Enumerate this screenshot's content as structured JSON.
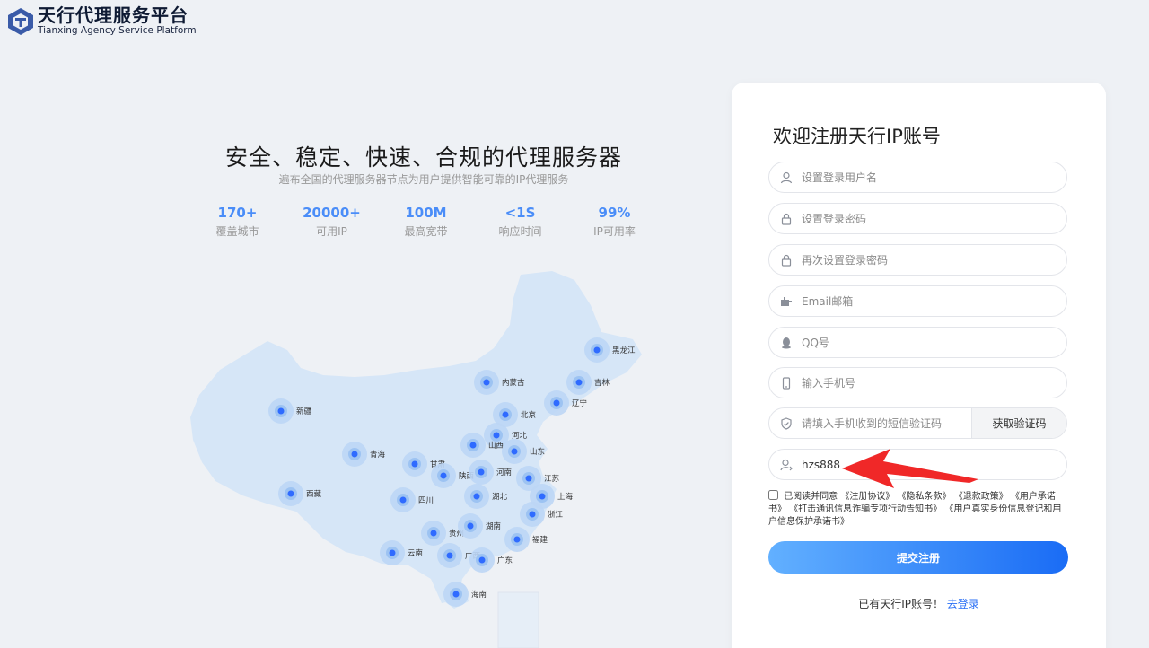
{
  "brand": {
    "name_cn": "天行代理服务平台",
    "name_en": "Tianxing Agency Service Platform",
    "logo_icon": "tx-hex-logo-icon"
  },
  "hero": {
    "title": "安全、稳定、快速、合规的代理服务器",
    "subtitle": "遍布全国的代理服务器节点为用户提供智能可靠的IP代理服务",
    "stats": [
      {
        "value": "170+",
        "label": "覆盖城市"
      },
      {
        "value": "20000+",
        "label": "可用IP"
      },
      {
        "value": "100M",
        "label": "最高宽带"
      },
      {
        "value": "<1S",
        "label": "响应时间"
      },
      {
        "value": "99%",
        "label": "IP可用率"
      }
    ]
  },
  "map": {
    "cities": [
      "黑龙江",
      "吉林",
      "辽宁",
      "内蒙古",
      "北京",
      "河北",
      "山西",
      "山东",
      "新疆",
      "青海",
      "甘肃",
      "陕西",
      "河南",
      "江苏",
      "上海",
      "西藏",
      "四川",
      "湖北",
      "浙江",
      "贵州",
      "湖南",
      "云南",
      "广西",
      "广东",
      "福建",
      "海南"
    ]
  },
  "form": {
    "title": "欢迎注册天行IP账号",
    "username_placeholder": "设置登录用户名",
    "password_placeholder": "设置登录密码",
    "password2_placeholder": "再次设置登录密码",
    "email_placeholder": "Email邮箱",
    "qq_placeholder": "QQ号",
    "phone_placeholder": "输入手机号",
    "sms_placeholder": "请填入手机收到的短信验证码",
    "sms_button": "获取验证码",
    "invite_value": "hzs888",
    "agree_prefix": "已阅读并同意",
    "agreements": [
      "《注册协议》",
      "《隐私条款》",
      "《退款政策》",
      "《用户承诺书》",
      "《打击通讯信息诈骗专项行动告知书》",
      "《用户真实身份信息登记和用户信息保护承诺书》"
    ],
    "submit_label": "提交注册",
    "login_prompt": "已有天行IP账号！",
    "login_link": "去登录"
  },
  "colors": {
    "accent": "#2a6ff5",
    "stat_blue": "#4a8df8",
    "map_fill": "#d6e6f7",
    "dot": "#2f6bff",
    "annotation_arrow": "#f02828"
  }
}
